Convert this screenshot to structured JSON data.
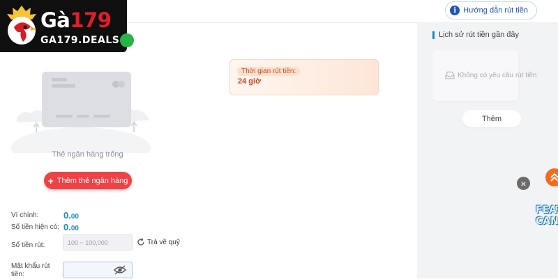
{
  "header": {
    "guide_label": "Hướng dẫn rút tiền",
    "guide_icon": "info-icon"
  },
  "logo": {
    "name_white": "Gà",
    "name_red": "179",
    "domain": "GA179.DEALS",
    "accent": "#e11d2a"
  },
  "bank_card": {
    "empty_text": "Thẻ ngân hàng trống",
    "add_button": "Thêm thẻ ngân hàng"
  },
  "withdraw_time": {
    "label": "Thời gian rút tiền:",
    "value": "24 giờ"
  },
  "form": {
    "main_wallet_label": "Ví chính:",
    "main_wallet_int": "0.",
    "main_wallet_dec": "00",
    "current_balance_label": "Số tiền hiện có:",
    "current_balance_int": "0.",
    "current_balance_dec": "00",
    "amount_label": "Số tiền rút:",
    "amount_placeholder": "100 ~ 100,000",
    "return_label": "Trả về quỹ",
    "password_label": "Mật khẩu rút tiền:"
  },
  "history": {
    "title": "Lịch sử rút tiền gần đây",
    "empty_text": "Không có yêu cầu rút tiền",
    "more_button": "Thêm"
  },
  "floating": {
    "close_glyph": "×",
    "promo_text": "FEATU CAN"
  },
  "colors": {
    "primary_red": "#f04145",
    "value_blue": "#1e87c8",
    "accent_orange": "#d03f1c"
  }
}
